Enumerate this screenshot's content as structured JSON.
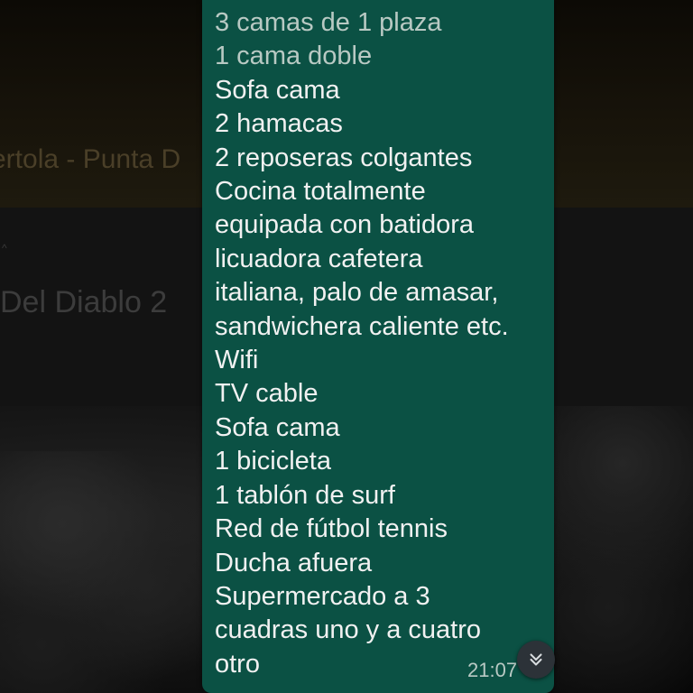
{
  "background": {
    "title_fragment": "ertola - Punta D",
    "subtitle_fragment": "Del Diablo 2"
  },
  "message": {
    "lines": [
      "3 camas de 1 plaza",
      "1 cama doble",
      "Sofa cama",
      "2 hamacas",
      "2 reposeras colgantes",
      "Cocina totalmente",
      "equipada con batidora",
      "licuadora cafetera",
      "italiana, palo de amasar,",
      "sandwichera caliente etc.",
      "Wifi",
      "TV cable",
      "Sofa cama",
      "1 bicicleta",
      "1 tablón de surf",
      "Red de fútbol tennis",
      "Ducha afuera",
      "Supermercado a 3",
      "cuadras uno y a cuatro",
      "otro"
    ],
    "time": "21:07"
  },
  "scroll_button": {
    "icon": "chevron-double-down-icon"
  },
  "colors": {
    "bubble": "#0b5144",
    "text": "#f1f1f1",
    "timestamp": "#b9c9c4",
    "scroll_button": "#2c3238"
  }
}
